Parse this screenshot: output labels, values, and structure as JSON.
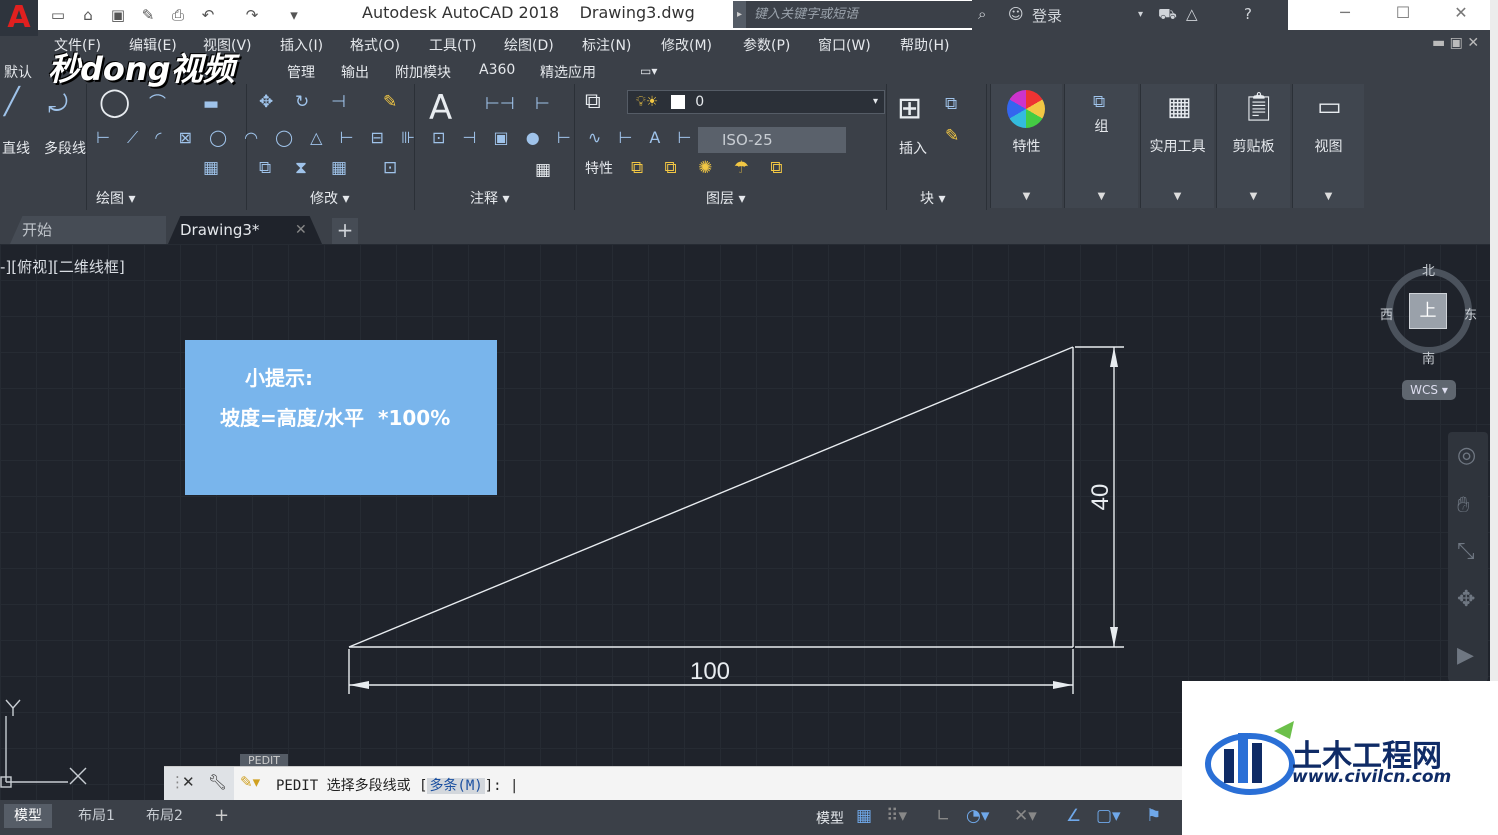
{
  "app": {
    "title": "Autodesk AutoCAD 2018",
    "file": "Drawing3.dwg"
  },
  "search": {
    "placeholder": "键入关键字或短语"
  },
  "account": {
    "login_label": "登录"
  },
  "menu": [
    "文件(F)",
    "编辑(E)",
    "视图(V)",
    "插入(I)",
    "格式(O)",
    "工具(T)",
    "绘图(D)",
    "标注(N)",
    "修改(M)",
    "参数(P)",
    "窗口(W)",
    "帮助(H)"
  ],
  "ribbon_tabs": [
    "默认",
    "管理",
    "输出",
    "附加模块",
    "A360",
    "精选应用"
  ],
  "watermark": "秒dong视频",
  "ribbon": {
    "draw_tools": {
      "line": "直线",
      "polyline": "多段线"
    },
    "panels": {
      "draw": "绘图",
      "modify": "修改",
      "annotate": "注释",
      "layers": "图层",
      "block": "块"
    },
    "layer_current": "0",
    "dimstyle": "ISO-25",
    "properties_small": "特性",
    "insert": "插入",
    "big": [
      "特性",
      "组",
      "实用工具",
      "剪贴板",
      "视图"
    ]
  },
  "doc_tabs": {
    "start": "开始",
    "drawing": "Drawing3*"
  },
  "viewport_label": "-][俯视][二维线框]",
  "hint": {
    "title": "小提示:",
    "formula": "坡度=高度/水平  *100%"
  },
  "dimensions": {
    "horizontal": "100",
    "vertical": "40"
  },
  "viewcube": {
    "north": "北",
    "south": "南",
    "east": "东",
    "west": "西",
    "face": "上",
    "wcs": "WCS"
  },
  "ucs": {
    "y": "Y",
    "x": "X"
  },
  "command": {
    "tag": "PEDIT",
    "prompt": "PEDIT 选择多段线或 [",
    "option": "多条(M)",
    "suffix": "]: "
  },
  "status": {
    "layouts": [
      "模型",
      "布局1",
      "布局2"
    ],
    "model_label": "模型"
  },
  "brand": {
    "name": "土木工程网",
    "url": "www.civilcn.com"
  }
}
